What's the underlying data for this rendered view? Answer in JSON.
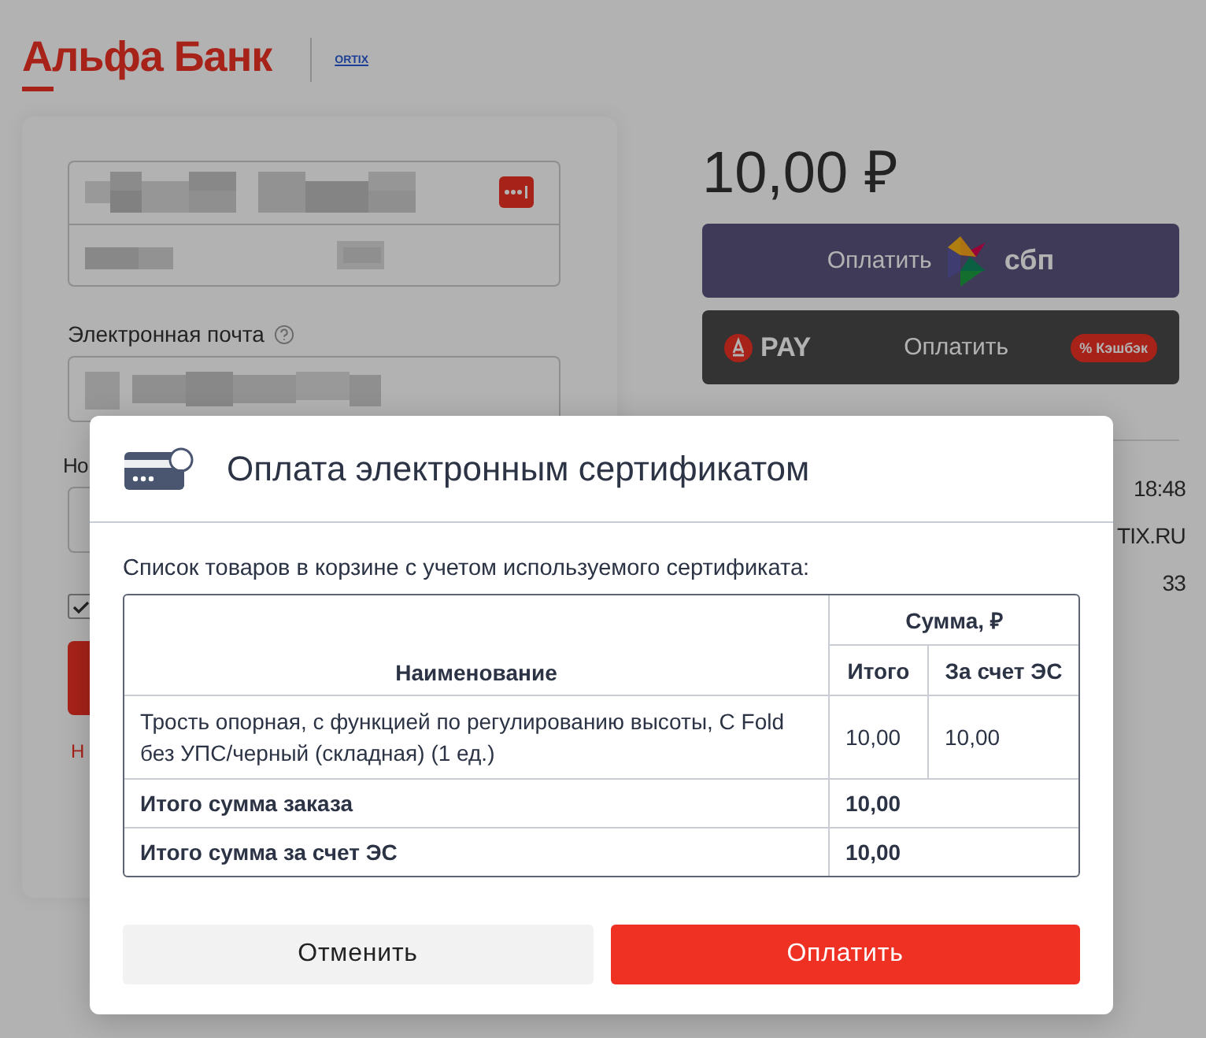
{
  "header": {
    "logo": "Альфа Банк",
    "partner_logo": "ORTIX"
  },
  "form": {
    "email_label": "Электронная почта",
    "covered_label": "Но",
    "consent_checked": true,
    "covered_note": "Н"
  },
  "payment": {
    "amount": "10,00 ₽",
    "sbp_button": {
      "label": "Оплатить",
      "brand": "сбп"
    },
    "alfa_pay_button": {
      "brand": "PAY",
      "label": "Оплатить",
      "badge": "% Кэшбэк"
    },
    "details": [
      "18:48",
      "TIX.RU",
      "33"
    ]
  },
  "dialog": {
    "title": "Оплата электронным сертификатом",
    "intro": "Список товаров в корзине с учетом используемого сертификата:",
    "table": {
      "columns": {
        "name": "Наименование",
        "sum_group": "Сумма, ₽",
        "total": "Итого",
        "certificate": "За счет ЭС"
      },
      "rows": [
        {
          "name": "Трость опорная, с функцией по регулированию высоты, С Fold без УПС/черный (складная) (1 ед.)",
          "total": "10,00",
          "certificate": "10,00"
        }
      ],
      "summary": [
        {
          "label": "Итого сумма заказа",
          "value": "10,00"
        },
        {
          "label": "Итого сумма за счет ЭС",
          "value": "10,00"
        }
      ]
    },
    "buttons": [
      {
        "label": "Отменить",
        "kind": "secondary"
      },
      {
        "label": "Оплатить",
        "kind": "primary"
      }
    ]
  }
}
